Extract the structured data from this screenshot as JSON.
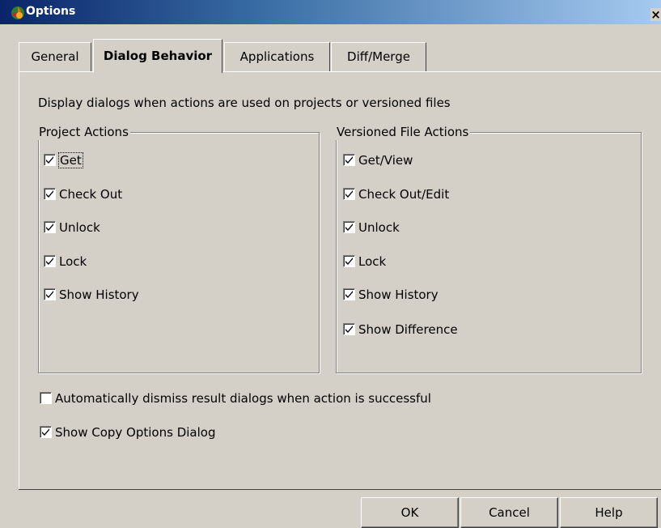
{
  "window": {
    "title": "Options",
    "close_glyph": "×"
  },
  "tabs": [
    {
      "label": "General",
      "active": false
    },
    {
      "label": "Dialog Behavior",
      "active": true
    },
    {
      "label": "Applications",
      "active": false
    },
    {
      "label": "Diff/Merge",
      "active": false
    }
  ],
  "description": "Display dialogs when actions are used on projects or versioned files",
  "project_actions": {
    "title": "Project Actions",
    "items": [
      {
        "label": "Get",
        "checked": true
      },
      {
        "label": "Check Out",
        "checked": true
      },
      {
        "label": "Unlock",
        "checked": true
      },
      {
        "label": "Lock",
        "checked": true
      },
      {
        "label": "Show History",
        "checked": true
      }
    ]
  },
  "versioned_file_actions": {
    "title": "Versioned File Actions",
    "items": [
      {
        "label": "Get/View",
        "checked": true
      },
      {
        "label": "Check Out/Edit",
        "checked": true
      },
      {
        "label": "Unlock",
        "checked": true
      },
      {
        "label": "Lock",
        "checked": true
      },
      {
        "label": "Show History",
        "checked": true
      },
      {
        "label": "Show Difference",
        "checked": true
      }
    ]
  },
  "options": {
    "auto_dismiss": {
      "label": "Automatically dismiss result dialogs when action is successful",
      "checked": false
    },
    "show_copy": {
      "label": "Show Copy Options Dialog",
      "checked": true
    }
  },
  "buttons": {
    "ok": "OK",
    "cancel": "Cancel",
    "help": "Help"
  }
}
